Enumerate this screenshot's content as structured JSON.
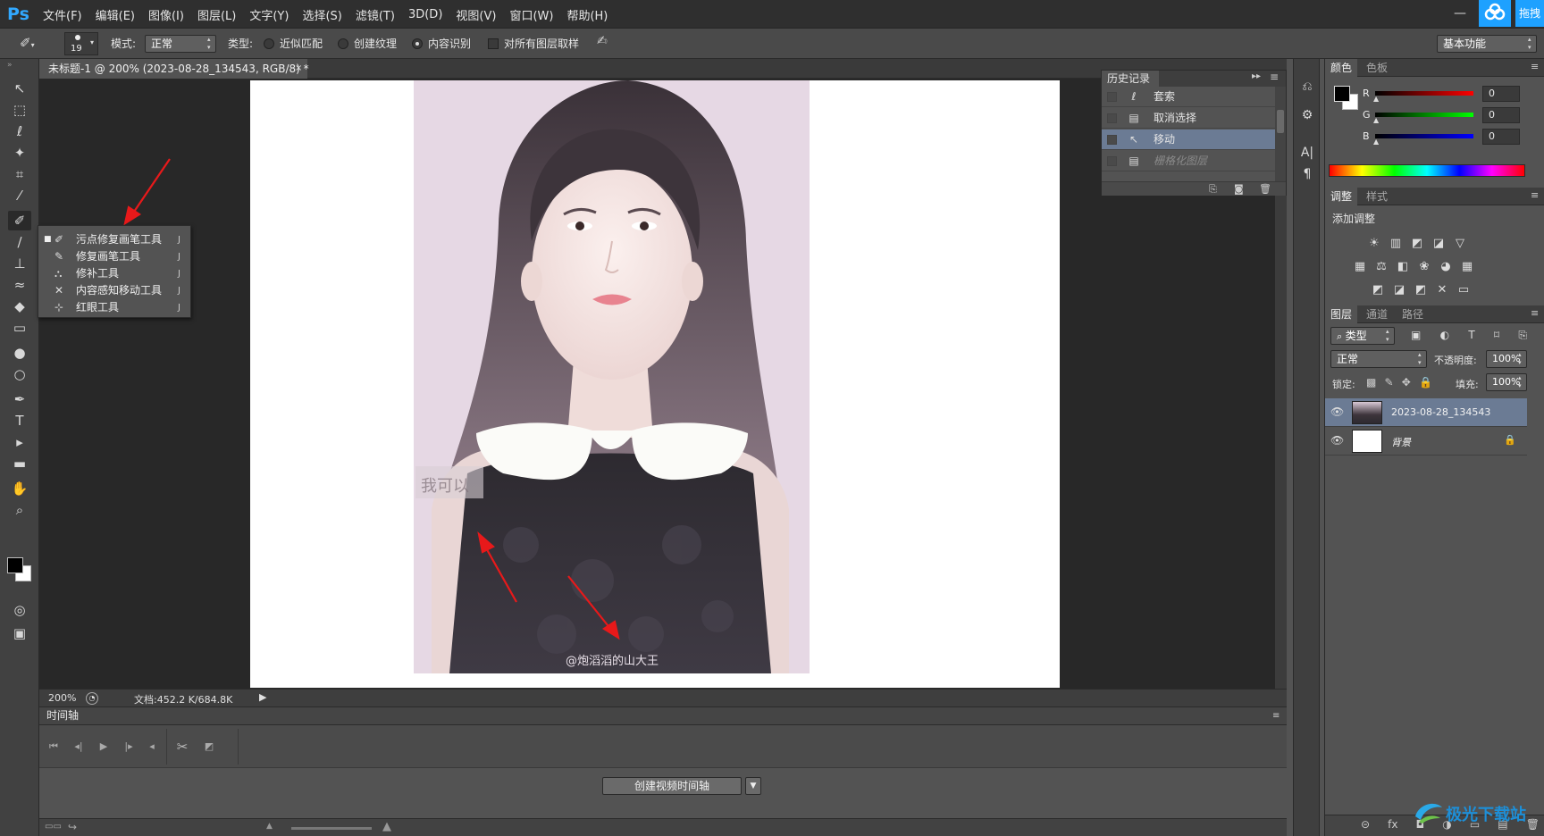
{
  "app": {
    "logo": "Ps",
    "menu": [
      "文件(F)",
      "编辑(E)",
      "图像(I)",
      "图层(L)",
      "文字(Y)",
      "选择(S)",
      "滤镜(T)",
      "3D(D)",
      "视图(V)",
      "窗口(W)",
      "帮助(H)"
    ],
    "minimize": "—",
    "cloud_label": "拖拽"
  },
  "options": {
    "brush_size": "19",
    "mode_label": "模式:",
    "mode_value": "正常",
    "type_label": "类型:",
    "type_options": [
      "近似匹配",
      "创建纹理",
      "内容识别"
    ],
    "type_selected": 2,
    "sample_all_label": "对所有图层取样",
    "workspace": "基本功能"
  },
  "document": {
    "tab_title": "未标题-1 @ 200% (2023-08-28_134543, RGB/8) *",
    "close": "×",
    "zoom": "200%",
    "doc_size": "文档:452.2 K/684.8K",
    "watermark_text": "@炮滔滔的山大王",
    "stamp_text": "我可以"
  },
  "flyout": {
    "items": [
      {
        "label": "污点修复画笔工具",
        "key": "J",
        "icon": "spot-healing-brush-icon",
        "glyph": "✐",
        "active": true
      },
      {
        "label": "修复画笔工具",
        "key": "J",
        "icon": "healing-brush-icon",
        "glyph": "✎",
        "active": false
      },
      {
        "label": "修补工具",
        "key": "J",
        "icon": "patch-icon",
        "glyph": "⛬",
        "active": false
      },
      {
        "label": "内容感知移动工具",
        "key": "J",
        "icon": "content-aware-move-icon",
        "glyph": "✕",
        "active": false
      },
      {
        "label": "红眼工具",
        "key": "J",
        "icon": "red-eye-icon",
        "glyph": "⊹",
        "active": false
      }
    ]
  },
  "toolbar": {
    "tools": [
      {
        "name": "move-tool-icon",
        "glyph": "↖"
      },
      {
        "name": "marquee-tool-icon",
        "glyph": "⬚"
      },
      {
        "name": "lasso-tool-icon",
        "glyph": "ℓ"
      },
      {
        "name": "magic-wand-tool-icon",
        "glyph": "✦"
      },
      {
        "name": "crop-tool-icon",
        "glyph": "⌗"
      },
      {
        "name": "eyedropper-tool-icon",
        "glyph": "⁄"
      },
      {
        "name": "healing-brush-tool-icon",
        "glyph": "✐"
      },
      {
        "name": "brush-tool-icon",
        "glyph": "∕"
      },
      {
        "name": "clone-stamp-tool-icon",
        "glyph": "⊥"
      },
      {
        "name": "history-brush-tool-icon",
        "glyph": "≈"
      },
      {
        "name": "eraser-tool-icon",
        "glyph": "◆"
      },
      {
        "name": "gradient-tool-icon",
        "glyph": "▭"
      },
      {
        "name": "blur-tool-icon",
        "glyph": "●"
      },
      {
        "name": "dodge-tool-icon",
        "glyph": "○"
      },
      {
        "name": "pen-tool-icon",
        "glyph": "✒"
      },
      {
        "name": "type-tool-icon",
        "glyph": "T"
      },
      {
        "name": "path-selection-tool-icon",
        "glyph": "▸"
      },
      {
        "name": "rectangle-tool-icon",
        "glyph": "▬"
      },
      {
        "name": "hand-tool-icon",
        "glyph": "✋"
      },
      {
        "name": "zoom-tool-icon",
        "glyph": "⌕"
      }
    ],
    "quick_mask": "◎",
    "screen_mode": "▣"
  },
  "history": {
    "tab": "历史记录",
    "rows": [
      {
        "label": "套索",
        "icon": "lasso-icon",
        "glyph": "ℓ",
        "state": "normal"
      },
      {
        "label": "取消选择",
        "icon": "document-icon",
        "glyph": "▤",
        "state": "normal"
      },
      {
        "label": "移动",
        "icon": "move-icon",
        "glyph": "↖",
        "state": "selected"
      },
      {
        "label": "栅格化图层",
        "icon": "document-icon",
        "glyph": "▤",
        "state": "dim"
      }
    ]
  },
  "color_panel": {
    "tabs": [
      "颜色",
      "色板"
    ],
    "channels": [
      {
        "label": "R",
        "value": "0",
        "color": "#ff0000"
      },
      {
        "label": "G",
        "value": "0",
        "color": "#00ff00"
      },
      {
        "label": "B",
        "value": "0",
        "color": "#0000ff"
      }
    ]
  },
  "adjust_panel": {
    "tabs": [
      "调整",
      "样式"
    ],
    "title": "添加调整",
    "icons_row1": [
      "☀",
      "▥",
      "◩",
      "◪",
      "▽"
    ],
    "icons_row2": [
      "▦",
      "⚖",
      "◧",
      "❀",
      "◕",
      "▦"
    ],
    "icons_row3": [
      "◩",
      "◪",
      "◩",
      "✕",
      "▭"
    ]
  },
  "layers_panel": {
    "tabs": [
      "图层",
      "通道",
      "路径"
    ],
    "filter_label": "类型",
    "blend_mode": "正常",
    "opacity_label": "不透明度:",
    "opacity_value": "100%",
    "lock_label": "锁定:",
    "fill_label": "填充:",
    "fill_value": "100%",
    "layers": [
      {
        "name": "2023-08-28_134543",
        "selected": true,
        "locked": false
      },
      {
        "name": "背景",
        "selected": false,
        "locked": true
      }
    ],
    "footer_icons": [
      "⊝",
      "fx",
      "◘",
      "◑",
      "▭",
      "▤",
      "🗑"
    ]
  },
  "timeline": {
    "title": "时间轴",
    "create_button": "创建视频时间轴",
    "dropdown": "▼"
  },
  "watermark": {
    "text": "极光下载站"
  },
  "colors": {
    "accent": "#31a8ff",
    "selection": "#6b7b94",
    "arrow": "#e8191a"
  }
}
